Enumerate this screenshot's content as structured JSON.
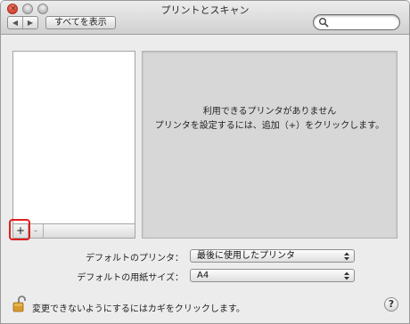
{
  "window": {
    "title": "プリントとスキャン"
  },
  "toolbar": {
    "back_glyph": "◀",
    "forward_glyph": "▶",
    "show_all_label": "すべてを表示",
    "search": {
      "value": "",
      "placeholder": ""
    }
  },
  "printer_list": {
    "add_label": "+",
    "remove_label": "-"
  },
  "detail": {
    "message_line1": "利用できるプリンタがありません",
    "message_line2": "プリンタを設定するには、追加（+）をクリックします。"
  },
  "settings": {
    "default_printer_label": "デフォルトのプリンタ：",
    "default_printer_value": "最後に使用したプリンタ",
    "default_paper_label": "デフォルトの用紙サイズ：",
    "default_paper_value": "A4"
  },
  "footer": {
    "lock_text": "変更できないようにするにはカギをクリックします。",
    "help_label": "?"
  },
  "colors": {
    "window_bg": "#ececec",
    "detail_bg": "#d7d7d7",
    "close_red": "#d2402b",
    "highlight_red": "#e0201e"
  },
  "icons": [
    "close-icon",
    "minimize-icon",
    "zoom-icon",
    "back-icon",
    "forward-icon",
    "search-icon",
    "popup-arrows-icon",
    "lock-icon",
    "help-icon"
  ]
}
